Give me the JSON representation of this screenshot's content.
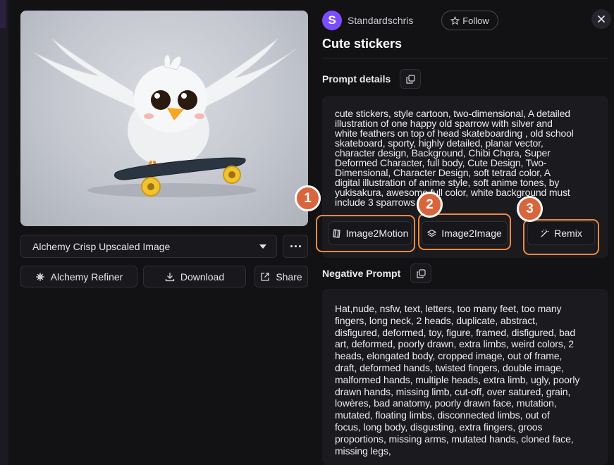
{
  "left_panel": {
    "model_select": {
      "value": "Alchemy Crisp Upscaled Image"
    },
    "buttons": {
      "refiner": "Alchemy Refiner",
      "download": "Download",
      "share": "Share"
    }
  },
  "header": {
    "avatar_letter": "S",
    "username": "Standardschris",
    "follow_label": "Follow",
    "title": "Cute stickers"
  },
  "prompt_details": {
    "label": "Prompt details",
    "lines": [
      "cute stickers, style cartoon, two-dimensional, A detailed",
      "illustration of one happy old sparrow with silver and",
      "white feathers on top of head skateboarding , old school",
      "skateboard, sporty, highly detailed, planar vector,",
      "character design, Background, Chibi Chara, Super",
      "Deformed Character, full body, Cute Design, Two-",
      "Dimensional, Character Design, soft tetrad color, A",
      "digital illustration of anime style, soft anime tones, by",
      "yukisakura, awesome full color, white background must",
      "include 3 sparrows"
    ]
  },
  "actions": {
    "image2motion": "Image2Motion",
    "image2image": "Image2Image",
    "remix": "Remix"
  },
  "markers": [
    "1",
    "2",
    "3"
  ],
  "negative_prompt": {
    "label": "Negative Prompt",
    "lines": [
      "Hat,nude, nsfw, text, letters, too many feet, too many",
      "fingers, long neck, 2 heads, duplicate, abstract,",
      "disfigured, deformed, toy, figure, framed, disfigured, bad",
      "art, deformed, poorly drawn, extra limbs, weird colors, 2",
      "heads, elongated body, cropped image, out of frame,",
      "draft, deformed hands, twisted fingers, double image,",
      "malformed hands, multiple heads, extra limb, ugly, poorly",
      "drawn hands, missing limb, cut-off, over satured, grain,",
      "lowères, bad anatomy, poorly drawn face, mutation,",
      "mutated, floating limbs, disconnected limbs, out of",
      "focus, long body, disgusting, extra fingers, groos",
      "proportions, missing arms, mutated hands, cloned face,",
      "missing legs,"
    ]
  },
  "colors": {
    "background": "#121214",
    "accent_purple": "#7c4dff",
    "highlight_orange": "#f08a3c",
    "marker_fill": "#d9653d"
  }
}
